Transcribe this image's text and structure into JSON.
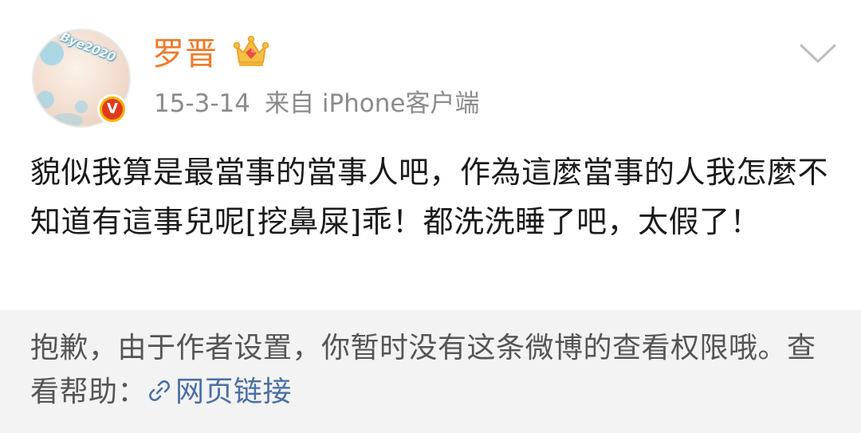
{
  "post": {
    "author": {
      "name": "罗晋",
      "avatar_text": "Bye2020",
      "verified_badge": "V",
      "badge_icon": "crown-icon"
    },
    "date": "15-3-14",
    "source": "来自 iPhone客户端",
    "content": "貌似我算是最當事的當事人吧，作為這麼當事的人我怎麼不知道有這事兒呢[挖鼻屎]乖！都洗洗睡了吧，太假了！"
  },
  "notice": {
    "text": "抱歉，由于作者设置，你暂时没有这条微博的查看权限哦。查看帮助：",
    "link_label": "网页链接"
  },
  "colors": {
    "username": "#f07a2a",
    "meta": "#8b8b8b",
    "body_text": "#1a1a1a",
    "notice_bg": "#f3f3f3",
    "notice_text": "#555555",
    "link": "#4a6fa5",
    "verified_outer": "#f7b500",
    "verified_inner": "#e03a1e"
  }
}
